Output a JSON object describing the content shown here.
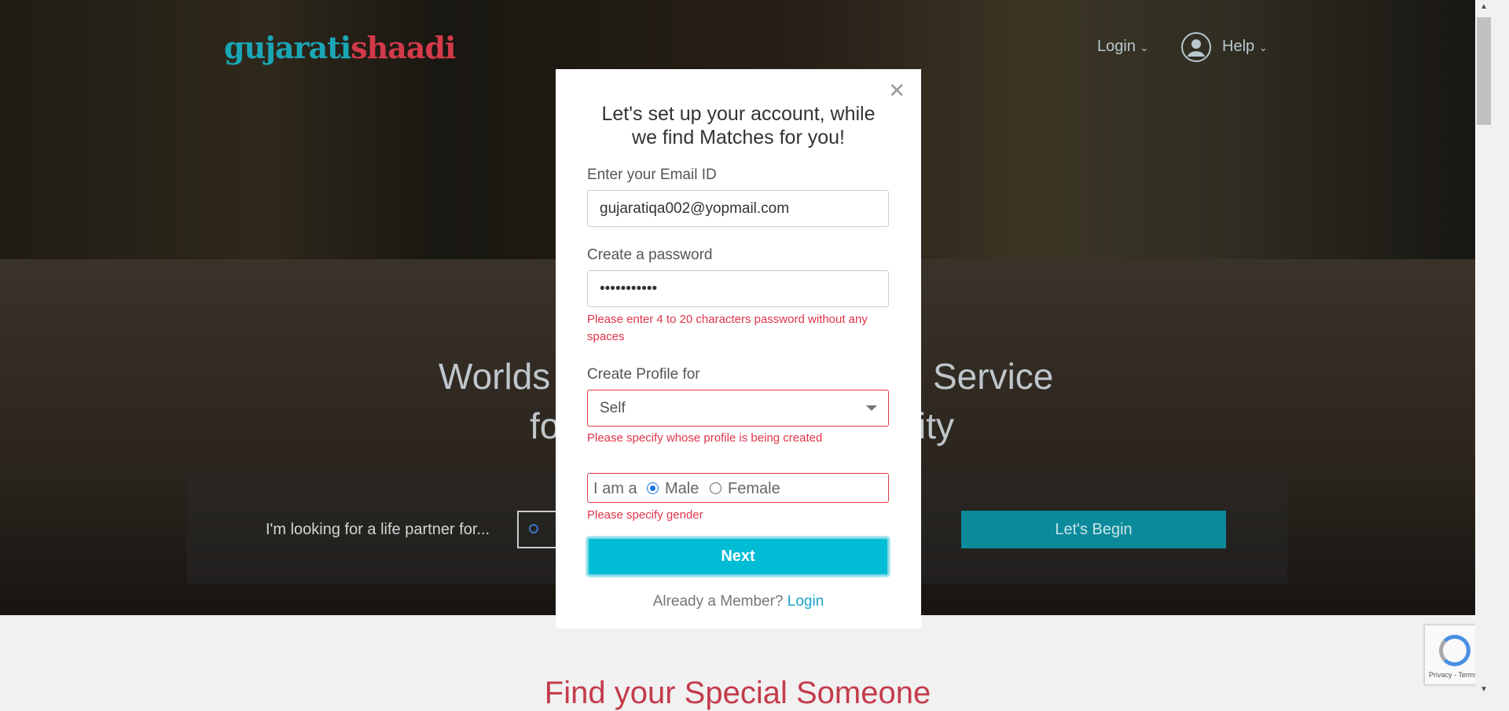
{
  "header": {
    "logo_part1": "gujarati",
    "logo_part2": "shaadi",
    "login_label": "Login",
    "help_label": "Help",
    "user_icon": "user-circle-icon",
    "chevron_icon": "chevron-down-icon"
  },
  "hero": {
    "title_line1": "Worlds",
    "title_line1_right": "Service",
    "title_line2_left": "fo",
    "title_line2_right": "ity",
    "search_prompt": "I'm looking for a life partner for...",
    "begin_button": "Let's Begin"
  },
  "section": {
    "special_heading": "Find your Special Someone"
  },
  "modal": {
    "title": "Let's set up your account, while we find Matches for you!",
    "close_icon": "close-icon",
    "email_label": "Enter your Email ID",
    "email_value": "gujaratiqa002@yopmail.com",
    "password_label": "Create a password",
    "password_value": "•••••••••••",
    "password_error": "Please enter 4 to 20 characters password without any spaces",
    "profile_label": "Create Profile for",
    "profile_selected": "Self",
    "profile_error": "Please specify whose profile is being created",
    "gender_prefix": "I am a",
    "gender_male": "Male",
    "gender_female": "Female",
    "gender_selected": "Male",
    "gender_error": "Please specify gender",
    "next_button": "Next",
    "already_member": "Already a Member?",
    "login_link": "Login"
  },
  "recaptcha": {
    "footer_text": "Privacy - Terms"
  },
  "colors": {
    "accent": "#00bcd4",
    "error": "#e0344a",
    "logo_teal": "#1aa6b7",
    "logo_red": "#d33a4a"
  }
}
